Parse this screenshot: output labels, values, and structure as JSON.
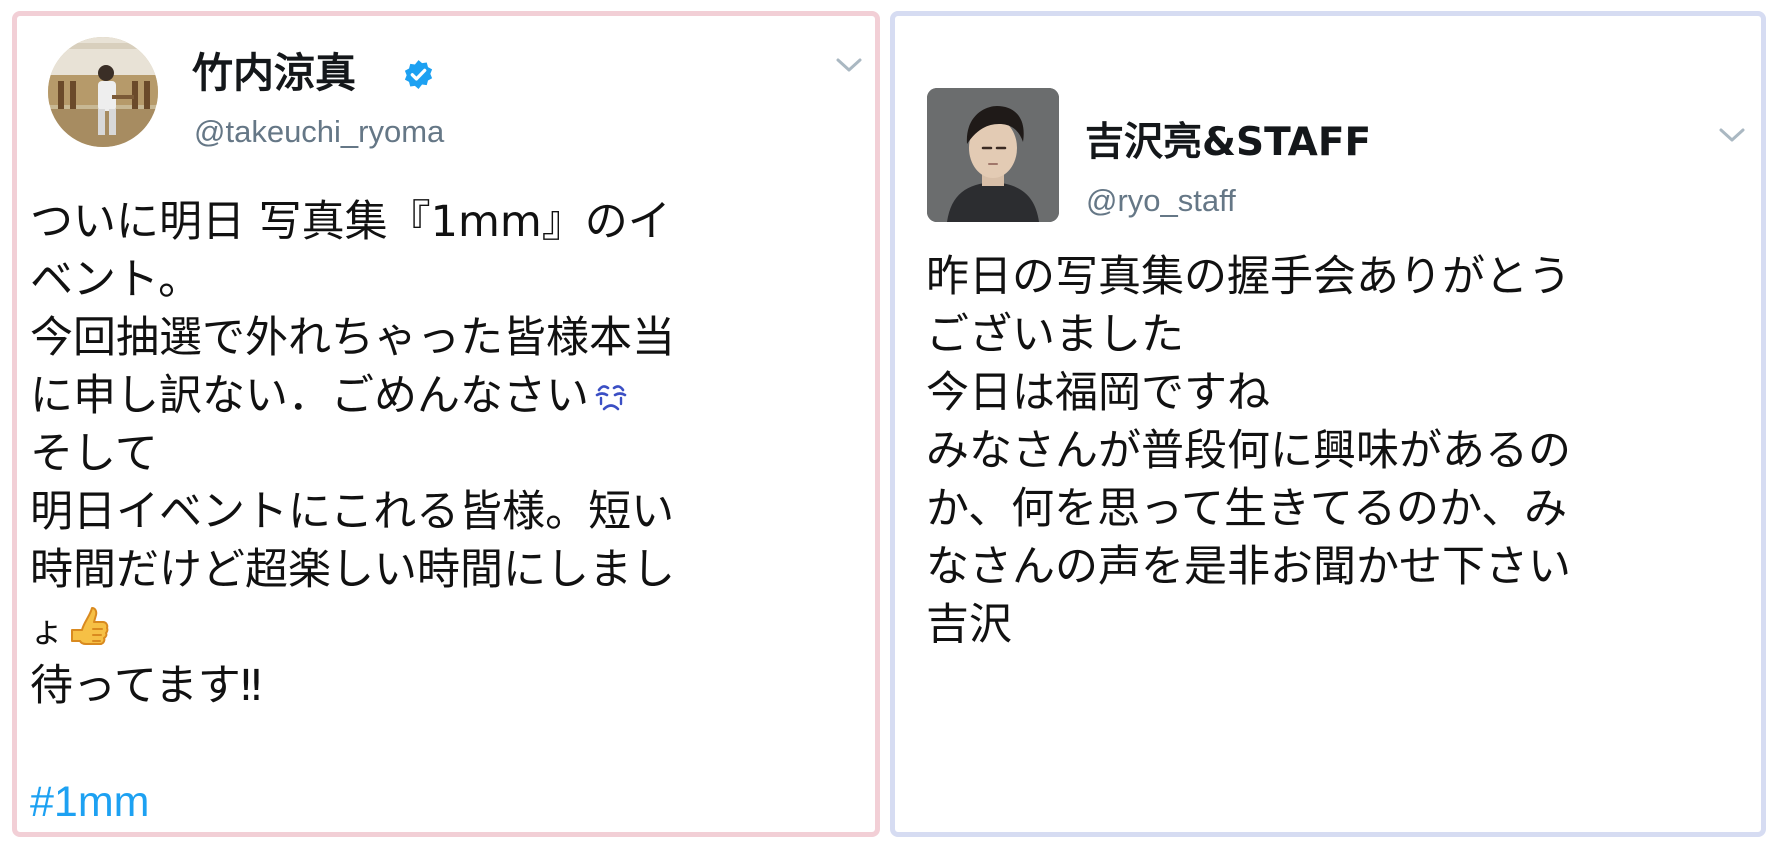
{
  "tweets": [
    {
      "display_name": "竹内涼真",
      "handle": "@takeuchi_ryoma",
      "verified_icon": "verified-badge",
      "lines": [
        "ついに明日 写真集『1mm』のイ",
        "ベント。",
        "今回抽選で外れちゃった皆様本当",
        "に申し訳ない．ごめんなさい",
        "そして",
        "明日イベントにこれる皆様。短い",
        "時間だけど超楽しい時間にしまし",
        "ょ",
        "待ってます‼"
      ],
      "emojis": {
        "sad": "crying-face-emoji",
        "thumbs": "thumbs-up-emoji"
      },
      "hashtag": "#1mm"
    },
    {
      "display_name": "吉沢亮&STAFF",
      "handle": "@ryo_staff",
      "lines": [
        "昨日の写真集の握手会ありがとう",
        "ございました",
        "今日は福岡ですね",
        "みなさんが普段何に興味があるの",
        "か、何を思って生きてるのか、み",
        "なさんの声を是非お聞かせ下さい",
        "吉沢"
      ]
    }
  ],
  "colors": {
    "left_border": "#f2cfd6",
    "right_border": "#d6dcf2",
    "hashtag": "#1da1f2",
    "handle": "#657786",
    "verified": "#1da1f2"
  }
}
